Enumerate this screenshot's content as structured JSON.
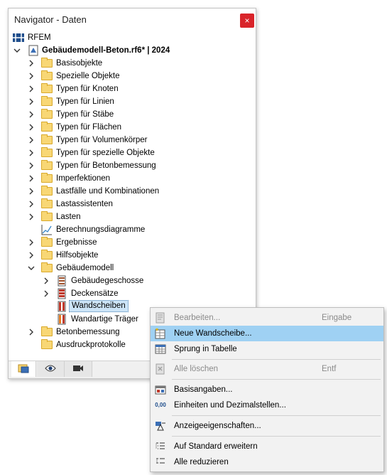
{
  "window": {
    "title": "Navigator - Daten",
    "close_glyph": "×"
  },
  "tree": {
    "root_label": "RFEM",
    "model_label": "Gebäudemodell-Beton.rf6* | 2024",
    "items": [
      "Basisobjekte",
      "Spezielle Objekte",
      "Typen für Knoten",
      "Typen für Linien",
      "Typen für Stäbe",
      "Typen für Flächen",
      "Typen für Volumenkörper",
      "Typen für spezielle Objekte",
      "Typen für Betonbemessung",
      "Imperfektionen",
      "Lastfälle und Kombinationen",
      "Lastassistenten",
      "Lasten",
      "Berechnungsdiagramme",
      "Ergebnisse",
      "Hilfsobjekte",
      "Gebäudemodell",
      "Gebäudegeschosse",
      "Deckensätze",
      "Wandscheiben",
      "Wandartige Träger",
      "Betonbemessung",
      "Ausdruckprotokolle"
    ]
  },
  "tabs": [
    "data-tab-icon",
    "view-tab-icon",
    "camera-tab-icon"
  ],
  "context_menu": {
    "items": [
      {
        "label": "Bearbeiten...",
        "shortcut": "Eingabe",
        "disabled": true
      },
      {
        "label": "Neue Wandscheibe...",
        "shortcut": "",
        "highlighted": true
      },
      {
        "label": "Sprung in Tabelle",
        "shortcut": ""
      },
      {
        "label": "Alle löschen",
        "shortcut": "Entf",
        "disabled": true
      },
      {
        "label": "Basisangaben...",
        "shortcut": ""
      },
      {
        "label": "Einheiten und Dezimalstellen...",
        "shortcut": "",
        "icon_text": "0,00"
      },
      {
        "label": "Anzeigeeigenschaften...",
        "shortcut": ""
      },
      {
        "label": "Auf Standard erweitern",
        "shortcut": ""
      },
      {
        "label": "Alle reduzieren",
        "shortcut": ""
      }
    ]
  },
  "colors": {
    "close_button": "#d9242a",
    "menu_highlight": "#9fd1f3",
    "selection": "#cce4f7",
    "folder": "#f8d775"
  }
}
